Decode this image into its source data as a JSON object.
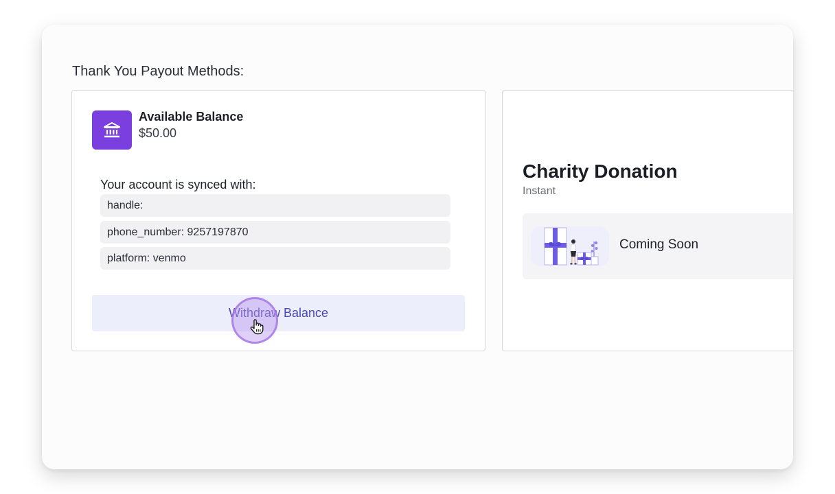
{
  "section_title": "Thank You Payout Methods:",
  "balance_card": {
    "icon": "bank-icon",
    "label": "Available Balance",
    "value": "$50.00",
    "synced_label": "Your account is synced with:",
    "synced_items": [
      "handle:",
      "phone_number: 9257197870",
      "platform: venmo"
    ],
    "withdraw_label": "Withdraw Balance"
  },
  "charity_card": {
    "title": "Charity Donation",
    "subtitle": "Instant",
    "status_text": "Coming Soon",
    "illustration": "gift-illustration"
  },
  "colors": {
    "accent_purple": "#7b3fe0",
    "button_bg": "#eceefc",
    "button_text": "#4848b0",
    "illustration_accent": "#6c5ce7"
  }
}
